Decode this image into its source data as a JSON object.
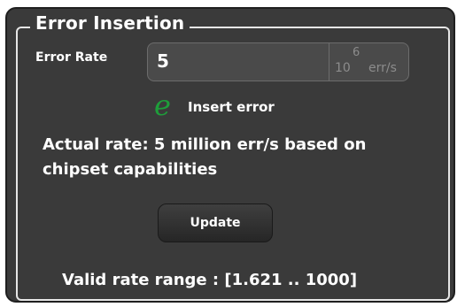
{
  "group": {
    "title": "Error Insertion"
  },
  "error_rate": {
    "label": "Error Rate",
    "value": "5",
    "unit_base": "10",
    "unit_exponent": "6",
    "unit_suffix": "err/s"
  },
  "insert": {
    "icon": "e",
    "label": "Insert error",
    "icon_color": "#1e9e3a"
  },
  "actual_rate": {
    "text": "Actual rate: 5 million err/s based on chipset capabilities"
  },
  "update_button": {
    "label": "Update"
  },
  "valid_range": {
    "text": "Valid rate range : [1.621 .. 1000]"
  }
}
